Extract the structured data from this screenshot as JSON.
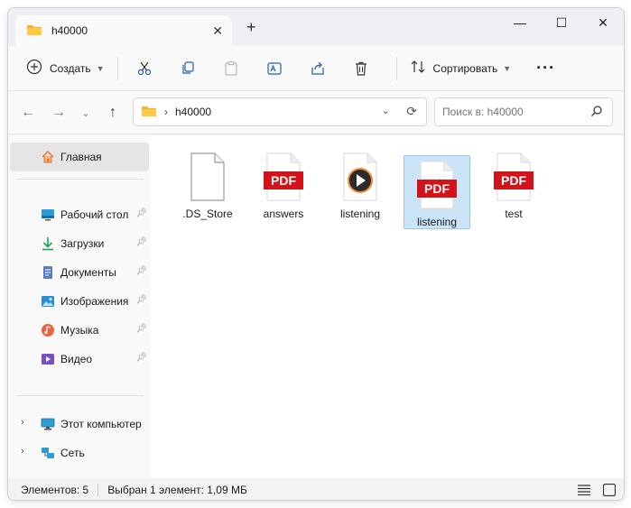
{
  "window": {
    "tab_title": "h40000",
    "tab_close": "✕",
    "new_tab": "+",
    "minimize": "—",
    "maximize": "☐",
    "close": "✕"
  },
  "toolbar": {
    "new_label": "Создать",
    "sort_label": "Сортировать",
    "more": "···"
  },
  "address": {
    "crumb": "h40000",
    "search_placeholder": "Поиск в: h40000"
  },
  "sidebar": {
    "home": "Главная",
    "quick": [
      {
        "label": "Рабочий стол",
        "icon": "desktop-icon"
      },
      {
        "label": "Загрузки",
        "icon": "downloads-icon"
      },
      {
        "label": "Документы",
        "icon": "documents-icon"
      },
      {
        "label": "Изображения",
        "icon": "pictures-icon"
      },
      {
        "label": "Музыка",
        "icon": "music-icon"
      },
      {
        "label": "Видео",
        "icon": "videos-icon"
      }
    ],
    "this_pc": "Этот компьютер",
    "network": "Сеть"
  },
  "files": [
    {
      "name": ".DS_Store",
      "type": "blank"
    },
    {
      "name": "answers",
      "type": "pdf"
    },
    {
      "name": "listening",
      "type": "media"
    },
    {
      "name": "listening",
      "type": "pdf",
      "selected": true
    },
    {
      "name": "test",
      "type": "pdf"
    }
  ],
  "pdf_badge": "PDF",
  "status": {
    "count": "Элементов: 5",
    "selected": "Выбран 1 элемент: 1,09 МБ"
  },
  "colors": {
    "pdf_red": "#d4121a",
    "folder_yellow": "#f2b23a",
    "selection": "#cce4f7",
    "accent": "#0067c0"
  }
}
